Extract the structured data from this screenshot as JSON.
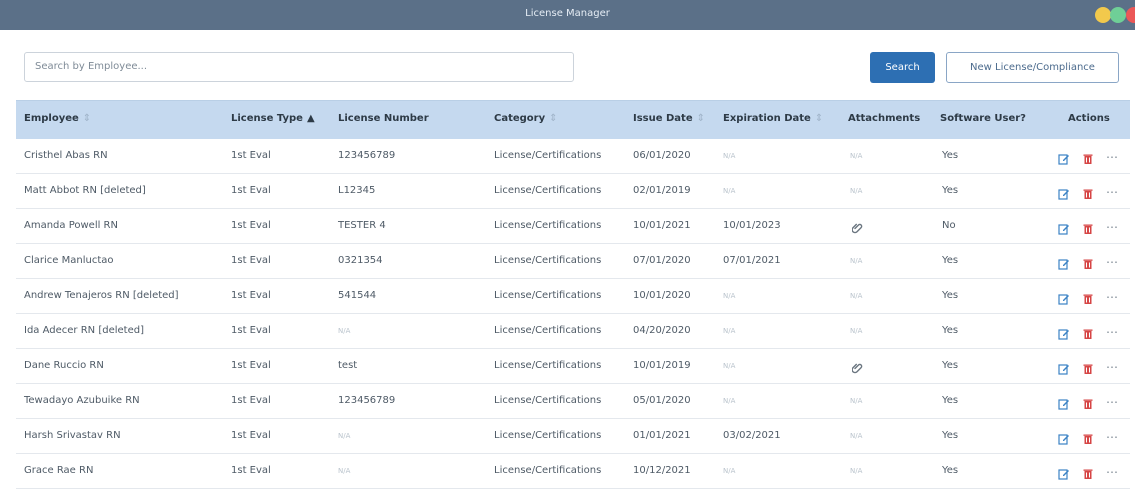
{
  "window": {
    "title": "License Manager"
  },
  "search": {
    "placeholder": "Search by Employee..."
  },
  "buttons": {
    "search": "Search",
    "new_license": "New License/Compliance"
  },
  "table": {
    "headers": {
      "employee": "Employee",
      "license_type": "License Type",
      "license_number": "License Number",
      "category": "Category",
      "issue_date": "Issue Date",
      "expiration_date": "Expiration Date",
      "attachments": "Attachments",
      "software_user": "Software User?",
      "actions": "Actions"
    },
    "sort": {
      "active_column": "License Type",
      "direction": "asc"
    },
    "rows": [
      {
        "employee": "Cristhel Abas RN",
        "license_type": "1st Eval",
        "license_number": "123456789",
        "category": "License/Certifications",
        "issue_date": "06/01/2020",
        "expiration_date": "N/A",
        "attachments": "N/A",
        "software_user": "Yes"
      },
      {
        "employee": "Matt Abbot RN [deleted]",
        "license_type": "1st Eval",
        "license_number": "L12345",
        "category": "License/Certifications",
        "issue_date": "02/01/2019",
        "expiration_date": "N/A",
        "attachments": "N/A",
        "software_user": "Yes"
      },
      {
        "employee": "Amanda Powell RN",
        "license_type": "1st Eval",
        "license_number": "TESTER 4",
        "category": "License/Certifications",
        "issue_date": "10/01/2021",
        "expiration_date": "10/01/2023",
        "attachments": "attachment",
        "software_user": "No"
      },
      {
        "employee": "Clarice Manluctao",
        "license_type": "1st Eval",
        "license_number": "0321354",
        "category": "License/Certifications",
        "issue_date": "07/01/2020",
        "expiration_date": "07/01/2021",
        "attachments": "N/A",
        "software_user": "Yes"
      },
      {
        "employee": "Andrew Tenajeros RN [deleted]",
        "license_type": "1st Eval",
        "license_number": "541544",
        "category": "License/Certifications",
        "issue_date": "10/01/2020",
        "expiration_date": "N/A",
        "attachments": "N/A",
        "software_user": "Yes"
      },
      {
        "employee": "Ida Adecer RN [deleted]",
        "license_type": "1st Eval",
        "license_number": "N/A",
        "category": "License/Certifications",
        "issue_date": "04/20/2020",
        "expiration_date": "N/A",
        "attachments": "N/A",
        "software_user": "Yes"
      },
      {
        "employee": "Dane Ruccio RN",
        "license_type": "1st Eval",
        "license_number": "test",
        "category": "License/Certifications",
        "issue_date": "10/01/2019",
        "expiration_date": "N/A",
        "attachments": "attachment",
        "software_user": "Yes"
      },
      {
        "employee": "Tewadayo Azubuike RN",
        "license_type": "1st Eval",
        "license_number": "123456789",
        "category": "License/Certifications",
        "issue_date": "05/01/2020",
        "expiration_date": "N/A",
        "attachments": "N/A",
        "software_user": "Yes"
      },
      {
        "employee": "Harsh Srivastav RN",
        "license_type": "1st Eval",
        "license_number": "N/A",
        "category": "License/Certifications",
        "issue_date": "01/01/2021",
        "expiration_date": "03/02/2021",
        "attachments": "N/A",
        "software_user": "Yes"
      },
      {
        "employee": "Grace Rae RN",
        "license_type": "1st Eval",
        "license_number": "N/A",
        "category": "License/Certifications",
        "issue_date": "10/12/2021",
        "expiration_date": "N/A",
        "attachments": "N/A",
        "software_user": "Yes"
      }
    ]
  },
  "icons": {
    "edit": "edit-icon",
    "delete": "trash-icon",
    "more": "more-icon",
    "attachment": "paperclip-icon"
  },
  "colors": {
    "titlebar": "#5b7088",
    "header": "#c5d9ef",
    "primary": "#2d6fb3",
    "edit": "#3b82c4",
    "delete": "#d64545"
  }
}
